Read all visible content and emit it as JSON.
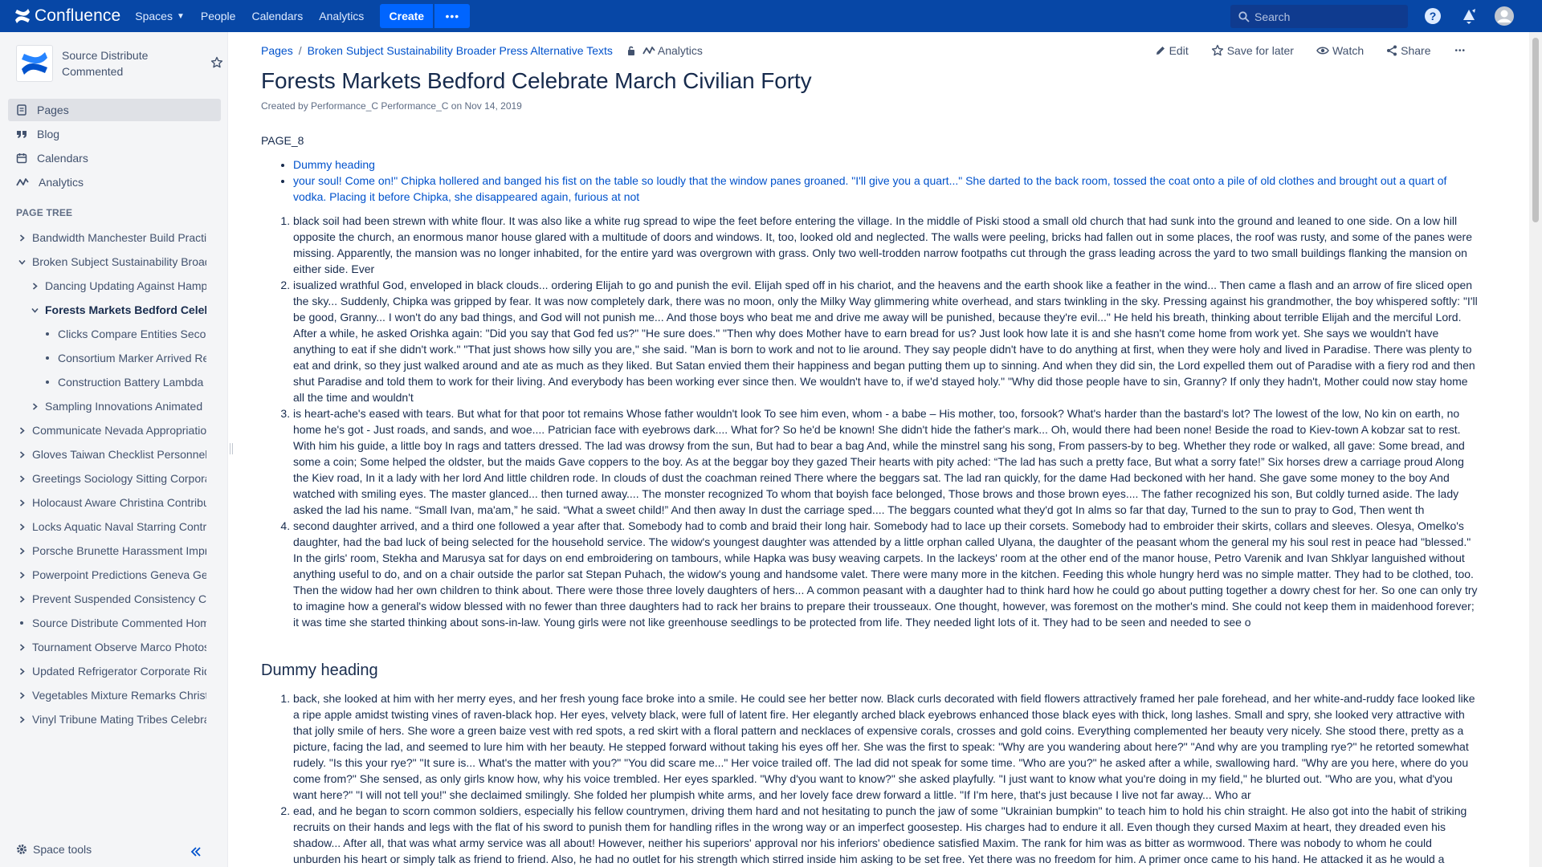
{
  "topnav": {
    "logo_text": "Confluence",
    "items": [
      "Spaces",
      "People",
      "Calendars",
      "Analytics"
    ],
    "create_label": "Create",
    "more_label": "•••",
    "search_placeholder": "Search",
    "colors": {
      "bar": "#0747a6",
      "create": "#0065ff"
    },
    "icons": [
      "help-icon",
      "notifications-icon",
      "avatar-icon"
    ]
  },
  "sidebar": {
    "space_name": "Source Distribute Commented",
    "nav": [
      {
        "label": "Pages",
        "icon": "pages-icon"
      },
      {
        "label": "Blog",
        "icon": "quote-icon"
      },
      {
        "label": "Calendars",
        "icon": "calendar-icon"
      },
      {
        "label": "Analytics",
        "icon": "analytics-icon"
      }
    ],
    "tree_title": "PAGE TREE",
    "tree": [
      {
        "label": "Bandwidth Manchester Build Practit",
        "level": 0,
        "toggle": "right"
      },
      {
        "label": "Broken Subject Sustainability Broad",
        "level": 0,
        "toggle": "down"
      },
      {
        "label": "Dancing Updating Against Hampto",
        "level": 1,
        "toggle": "right"
      },
      {
        "label": "Forests Markets Bedford Celeb",
        "level": 1,
        "toggle": "down",
        "current": true
      },
      {
        "label": "Clicks Compare Entities Second",
        "level": 2,
        "toggle": "bullet"
      },
      {
        "label": "Consortium Marker Arrived Res",
        "level": 2,
        "toggle": "bullet"
      },
      {
        "label": "Construction Battery Lambda C",
        "level": 2,
        "toggle": "bullet"
      },
      {
        "label": "Sampling Innovations Animated P",
        "level": 1,
        "toggle": "right"
      },
      {
        "label": "Communicate Nevada Appropriation",
        "level": 0,
        "toggle": "right"
      },
      {
        "label": "Gloves Taiwan Checklist Personnel",
        "level": 0,
        "toggle": "right"
      },
      {
        "label": "Greetings Sociology Sitting Corpora",
        "level": 0,
        "toggle": "right"
      },
      {
        "label": "Holocaust Aware Christina Contribu",
        "level": 0,
        "toggle": "right"
      },
      {
        "label": "Locks Aquatic Naval Starring Contri",
        "level": 0,
        "toggle": "right"
      },
      {
        "label": "Porsche Brunette Harassment Impro",
        "level": 0,
        "toggle": "right"
      },
      {
        "label": "Powerpoint Predictions Geneva Gen",
        "level": 0,
        "toggle": "right"
      },
      {
        "label": "Prevent Suspended Consistency Co",
        "level": 0,
        "toggle": "right"
      },
      {
        "label": "Source Distribute Commented Hom",
        "level": 0,
        "toggle": "bullet"
      },
      {
        "label": "Tournament Observe Marco Photos",
        "level": 0,
        "toggle": "right"
      },
      {
        "label": "Updated Refrigerator Corporate Rid",
        "level": 0,
        "toggle": "right"
      },
      {
        "label": "Vegetables Mixture Remarks Christo",
        "level": 0,
        "toggle": "right"
      },
      {
        "label": "Vinyl Tribune Mating Tribes Celebra",
        "level": 0,
        "toggle": "right"
      }
    ],
    "space_tools_label": "Space tools"
  },
  "page": {
    "breadcrumbs": [
      "Pages",
      "Broken Subject Sustainability Broader Press Alternative Texts"
    ],
    "breadcrumb_analytics": "Analytics",
    "actions": {
      "edit": "Edit",
      "save": "Save for later",
      "watch": "Watch",
      "share": "Share",
      "more": "•••"
    },
    "title": "Forests Markets Bedford Celebrate March Civilian Forty",
    "byline": "Created by Performance_C Performance_C on Nov 14, 2019",
    "lead": "PAGE_8",
    "toc": [
      "Dummy heading",
      "your soul! Come on!\" Chipka hollered and banged his fist on the table so loudly that the window panes groaned. \"I'll give you a quart...\" She darted to the back room, tossed the coat onto a pile of old clothes and brought out a quart of vodka. Placing it before Chipka, she disappeared again, furious at not"
    ],
    "list1": [
      "black soil had been strewn with white flour. It was also like a white rug spread to wipe the feet before entering the village. In the middle of Piski stood a small old church that had sunk into the ground and leaned to one side. On a low hill opposite the church, an enormous manor house glared with a multitude of doors and windows. It, too, looked old and neglected. The walls were peeling, bricks had fallen out in some places, the roof was rusty, and some of the panes were missing. Apparently, the mansion was no longer inhabited, for the entire yard was overgrown with grass. Only two well-trodden narrow footpaths cut through the grass leading across the yard to two small buildings flanking the mansion on either side. Ever",
      "isualized wrathful God, enveloped in black clouds... ordering Elijah to go and punish the evil. Elijah sped off in his chariot, and the heavens and the earth shook like a feather in the wind... Then came a flash and an arrow of fire sliced open the sky... Suddenly, Chipka was gripped by fear. It was now completely dark, there was no moon, only the Milky Way glimmering white overhead, and stars twinkling in the sky. Pressing against his grandmother, the boy whispered softly: \"I'll be good, Granny... I won't do any bad things, and God will not punish me... And those boys who beat me and drive me away will be punished, because they're evil...\" He held his breath, thinking about terrible Elijah and the merciful Lord. After a while, he asked Orishka again: \"Did you say that God fed us?\" \"He sure does.\" \"Then why does Mother have to earn bread for us? Just look how late it is and she hasn't come home from work yet. She says we wouldn't have anything to eat if she didn't work.\" \"That just shows how silly you are,\" she said. \"Man is born to work and not to lie around. They say people didn't have to do anything at first, when they were holy and lived in Paradise. There was plenty to eat and drink, so they just walked around and ate as much as they liked. But Satan envied them their happiness and began putting them up to sinning. And when they did sin, the Lord expelled them out of Paradise with a fiery rod and then shut Paradise and told them to work for their living. And everybody has been working ever since then. We wouldn't have to, if we'd stayed holy.\" \"Why did those people have to sin, Granny? If only they hadn't, Mother could now stay home all the time and wouldn't",
      "is heart-ache's eased with tears. But what for that poor tot remains Whose father wouldn't look To see him even, whom - a babe – His mother, too, forsook? What's harder than the bastard's lot? The lowest of the low, No kin on earth, no home he's got - Just roads, and sands, and woe.... Patrician face with eyebrows dark.... What for? So he'd be known! She didn't hide the father's mark... Oh, would there had been none! Beside the road to Kiev-town A kobzar sat to rest. With him his guide, a little boy In rags and tatters dressed. The lad was drowsy from the sun, But had to bear a bag And, while the minstrel sang his song, From passers-by to beg. Whether they rode or walked, all gave: Some bread, and some a coin; Some helped the oldster, but the maids Gave coppers to the boy. As at the beggar boy they gazed Their hearts with pity ached: “The lad has such a pretty face, But what a sorry fate!” Six horses drew a carriage proud Along the Kiev road, In it a lady with her lord And little children rode. In clouds of dust the coachman reined There where the beggars sat. The lad ran quickly, for the dame Had beckoned with her hand. She gave some money to the boy And watched with smiling eyes. The master glanced... then turned away.... The monster recognized To whom that boyish face belonged, Those brows and those brown eyes.... The father recognized his son, But coldly turned aside. The lady asked the lad his name. “Small Ivan, ma'am,” he said. “What a sweet child!” And then away In dust the carriage sped.... The beggars counted what they'd got In alms so far that day, Turned to the sun to pray to God, Then went th",
      "second daughter arrived, and a third one followed a year after that. Somebody had to comb and braid their long hair. Somebody had to lace up their corsets. Somebody had to embroider their skirts, collars and sleeves. Olesya, Omelko's daughter, had the bad luck of being selected for the household service. The widow's youngest daughter was attended by a little orphan called Ulyana, the daughter of the peasant whom the general my his soul rest in peace had \"blessed.\" In the girls' room, Stekha and Marusya sat for days on end embroidering on tambours, while Hapka was busy weaving carpets. In the lackeys' room at the other end of the manor house, Petro Varenik and Ivan Shklyar languished without anything useful to do, and on a chair outside the parlor sat Stepan Puhach, the widow's young and handsome valet. There were many more in the kitchen. Feeding this whole hungry herd was no simple matter. They had to be clothed, too. Then the widow had her own children to think about. There were those three lovely daughters of hers... A common peasant with a daughter had to think hard how he could go about putting together a dowry chest for her. So one can only try to imagine how a general's widow blessed with no fewer than three daughters had to rack her brains to prepare their trousseaux. One thought, however, was foremost on the mother's mind. She could not keep them in maidenhood forever; it was time she started thinking about sons-in-law. Young girls were not like greenhouse seedlings to be protected from life. They needed light lots of it. They had to be seen and needed to see o"
    ],
    "heading": "Dummy heading",
    "list2": [
      "back, she looked at him with her merry eyes, and her fresh young face broke into a smile. He could see her better now. Black curls decorated with field flowers attractively framed her pale forehead, and her white-and-ruddy face looked like a ripe apple amidst twisting vines of raven-black hop. Her eyes, velvety black, were full of latent fire. Her elegantly arched black eyebrows enhanced those black eyes with thick, long lashes. Small and spry, she looked very attractive with that jolly smile of hers. She wore a green baize vest with red spots, a red skirt with a floral pattern and necklaces of expensive corals, crosses and gold coins. Everything complemented her beauty very nicely. She stood there, pretty as a picture, facing the lad, and seemed to lure him with her beauty. He stepped forward without taking his eyes off her. She was the first to speak: \"Why are you wandering about here?\" \"And why are you trampling rye?\" he retorted somewhat rudely. \"Is this your rye?\" \"It sure is... What's the matter with you?\" \"You did scare me...\" Her voice trailed off. The lad did not speak for some time. \"Who are you?\" he asked after a while, swallowing hard. \"Why are you here, where do you come from?\" She sensed, as only girls know how, why his voice trembled. Her eyes sparkled. \"Why d'you want to know?\" she asked playfully. \"I just want to know what you're doing in my field,\" he blurted out. \"Who are you, what d'you want here?\" \"I will not tell you!\" she declaimed smilingly. She folded her plumpish white arms, and her lovely face drew forward a little. \"If I'm here, that's just because I live not far away... Who ar",
      "ead, and he began to scorn common soldiers, especially his fellow countrymen, driving them hard and not hesitating to punch the jaw of some \"Ukrainian bumpkin\" to teach him to hold his chin straight. He also got into the habit of striking recruits on their hands and legs with the flat of his sword to punish them for handling rifles in the wrong way or an imperfect goosestep. His charges had to endure it all. Even though they cursed Maxim at heart, they dreaded even his shadow... After all, that was what army service was all about! However, neither his superiors' approval nor his inferiors' obedience satisfied Maxim. The rank for him was as bitter as wormwood. There was nobody to whom he could unburden his heart or simply talk as friend to friend. Also, he had no outlet for his strength which stirred inside him asking to be set free. Yet there was no freedom for him. A primer once came to his hand. He attacked it as he would a fortress wall. Had never sat to let a single word be ignored, and whether in ABC, but he quickly finished it, after which, learning the art of reading, took up the Prayer Book and "
    ]
  }
}
